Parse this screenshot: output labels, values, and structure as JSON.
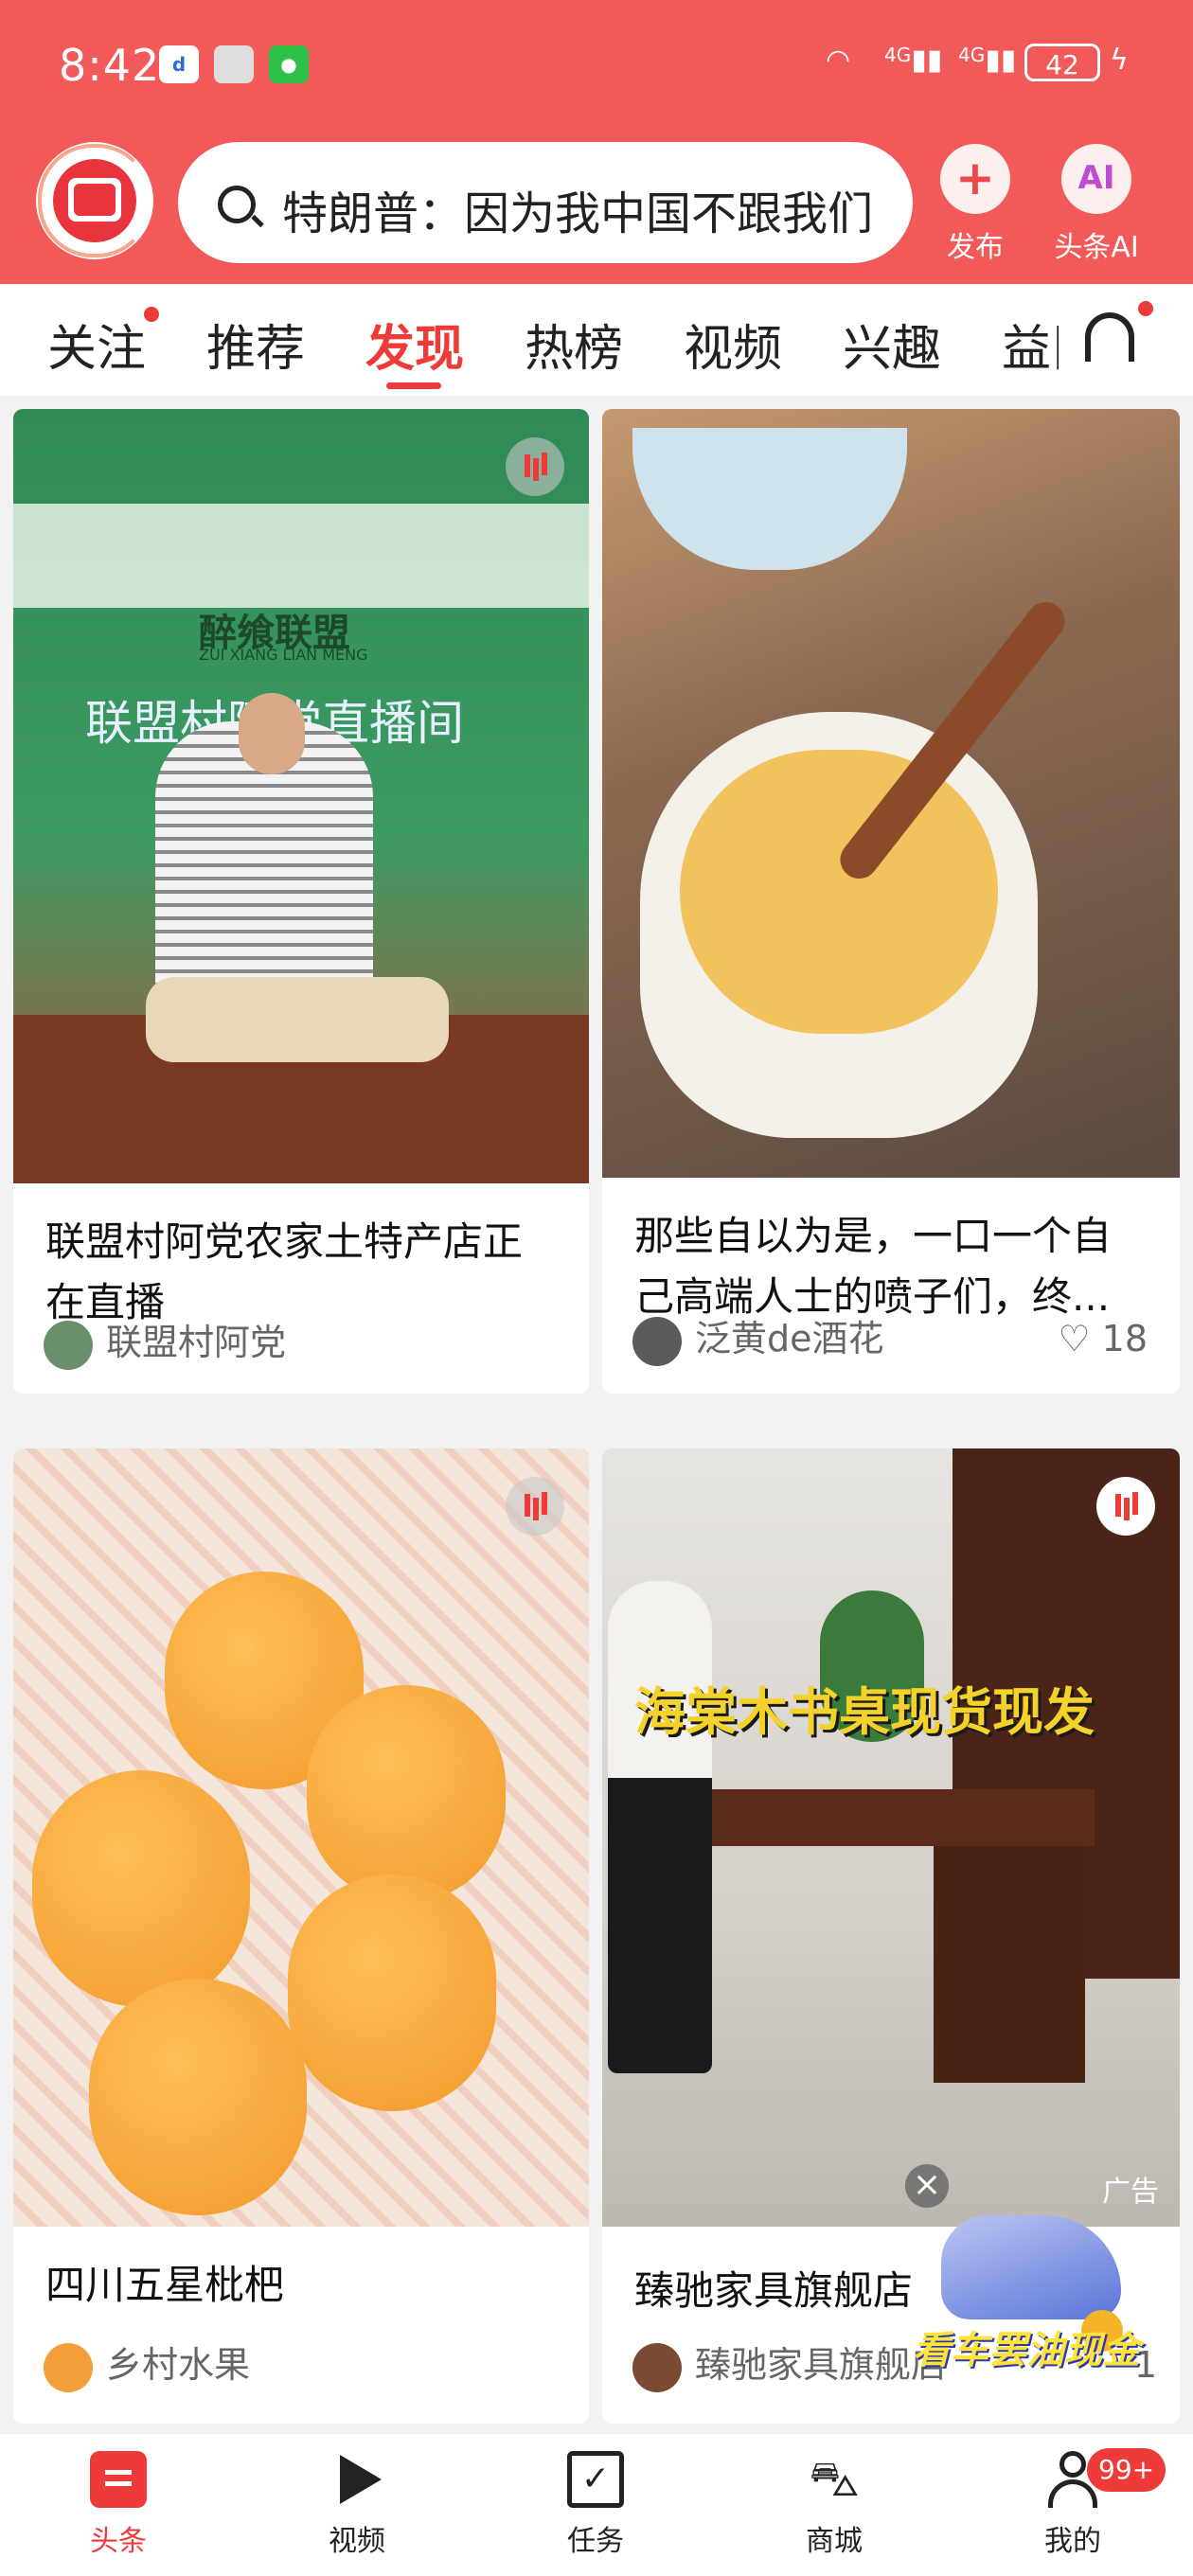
{
  "status_bar": {
    "time": "8:42",
    "signal1": "4G",
    "signal2": "4G",
    "battery": "42"
  },
  "search": {
    "placeholder": "特朗普：因为我中国不跟我们"
  },
  "top_actions": {
    "publish_label": "发布",
    "ai_label": "头条AI",
    "ai_icon_text": "AI"
  },
  "tabs": [
    "关注",
    "推荐",
    "发现",
    "热榜",
    "视频",
    "兴趣",
    "益阝"
  ],
  "active_tab": "发现",
  "cards": [
    {
      "title_line1": "联盟村阿党农家土特产店正",
      "title_line2": "在直播",
      "author": "联盟村阿党",
      "banner_brand": "醉飨联盟",
      "banner_brand_en": "ZUI XIANG LIAN MENG",
      "banner_text": "联盟村阿党直播间"
    },
    {
      "title_line1": "那些自以为是，一口一个自",
      "title_line2": "己高端人士的喷子们，终...",
      "author": "泛黄de酒花",
      "likes": "18"
    },
    {
      "title": "四川五星枇杷",
      "author": "乡村水果"
    },
    {
      "title": "臻驰家具旗舰店",
      "author": "臻驰家具旗舰店",
      "overlay_text": "海棠木书桌现货现发",
      "ad_label": "广告",
      "ad_promo": "看车罢油现金",
      "ad_count": "1"
    }
  ],
  "bottom_nav": [
    {
      "label": "头条",
      "icon": "toutiao-icon"
    },
    {
      "label": "视频",
      "icon": "play-icon"
    },
    {
      "label": "任务",
      "icon": "task-icon"
    },
    {
      "label": "商城",
      "icon": "cart-icon"
    },
    {
      "label": "我的",
      "icon": "profile-icon"
    }
  ],
  "profile_badge": "99+",
  "colors": {
    "brand": "#f25a5a",
    "accent": "#ef3a3a"
  }
}
